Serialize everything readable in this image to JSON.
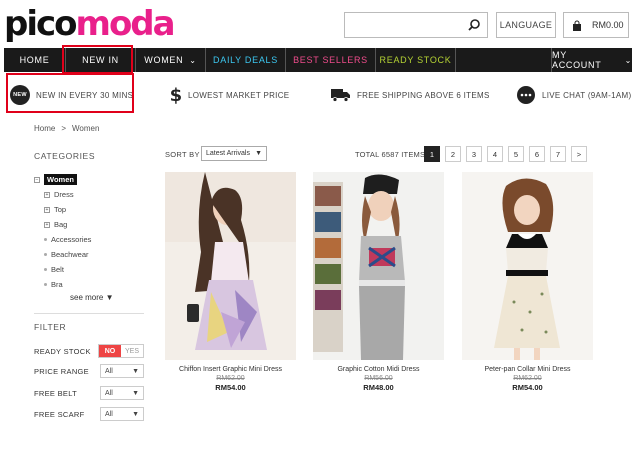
{
  "brand": {
    "part1": "pico",
    "part2": "moda",
    "color1": "#111111",
    "color2": "#e9208b"
  },
  "header": {
    "search_placeholder": "",
    "language_label": "LANGUAGE",
    "cart_total": "RM0.00"
  },
  "nav": {
    "items": [
      {
        "label": "HOME",
        "color": "#ffffff"
      },
      {
        "label": "NEW IN",
        "color": "#ffffff"
      },
      {
        "label": "WOMEN",
        "color": "#ffffff",
        "chevron": "chevron-down-icon"
      },
      {
        "label": "DAILY DEALS",
        "color": "#3cc7f0"
      },
      {
        "label": "BEST SELLERS",
        "color": "#f04c8c"
      },
      {
        "label": "READY STOCK",
        "color": "#b5d334"
      },
      {
        "label": "MY ACCOUNT",
        "color": "#ffffff",
        "chevron": "chevron-down-icon"
      }
    ],
    "highlight_color": "#e0001a"
  },
  "usp": [
    {
      "icon": "new-badge-icon",
      "badge": "NEW",
      "text": "NEW IN EVERY 30 MINS"
    },
    {
      "icon": "dollar-icon",
      "text": "LOWEST MARKET PRICE"
    },
    {
      "icon": "truck-icon",
      "text": "FREE SHIPPING ABOVE 6 ITEMS"
    },
    {
      "icon": "chat-icon",
      "text": "LIVE CHAT (9AM-1AM)"
    }
  ],
  "breadcrumb": {
    "home": "Home",
    "sep": ">",
    "current": "Women"
  },
  "sidebar": {
    "categories_title": "CATEGORIES",
    "categories": [
      {
        "label": "Women",
        "marker": "−",
        "level": 0
      },
      {
        "label": "Dress",
        "marker": "+",
        "level": 1
      },
      {
        "label": "Top",
        "marker": "+",
        "level": 1
      },
      {
        "label": "Bag",
        "marker": "+",
        "level": 1
      },
      {
        "label": "Accessories",
        "marker": "",
        "level": 1
      },
      {
        "label": "Beachwear",
        "marker": "",
        "level": 1
      },
      {
        "label": "Belt",
        "marker": "",
        "level": 1
      },
      {
        "label": "Bra",
        "marker": "",
        "level": 1
      }
    ],
    "see_more": "see more ▼",
    "filter_title": "FILTER",
    "filters": [
      {
        "label": "READY STOCK",
        "type": "toggle",
        "no": "NO",
        "yes": "YES"
      },
      {
        "label": "PRICE RANGE",
        "type": "select",
        "value": "All"
      },
      {
        "label": "FREE BELT",
        "type": "select",
        "value": "All"
      },
      {
        "label": "FREE SCARF",
        "type": "select",
        "value": "All"
      }
    ]
  },
  "listing": {
    "sort_label": "SORT BY",
    "sort_value": "Latest Arrivals",
    "total": "TOTAL 6587 ITEMS",
    "pages": [
      "1",
      "2",
      "3",
      "4",
      "5",
      "6",
      "7",
      ">"
    ],
    "active_page": "1"
  },
  "products": [
    {
      "name": "Chiffon Insert Graphic Mini Dress",
      "old_price": "RM62.00",
      "price": "RM54.00"
    },
    {
      "name": "Graphic Cotton Midi Dress",
      "old_price": "RM56.00",
      "price": "RM48.00"
    },
    {
      "name": "Peter-pan Collar Mini Dress",
      "old_price": "RM62.00",
      "price": "RM54.00"
    }
  ]
}
